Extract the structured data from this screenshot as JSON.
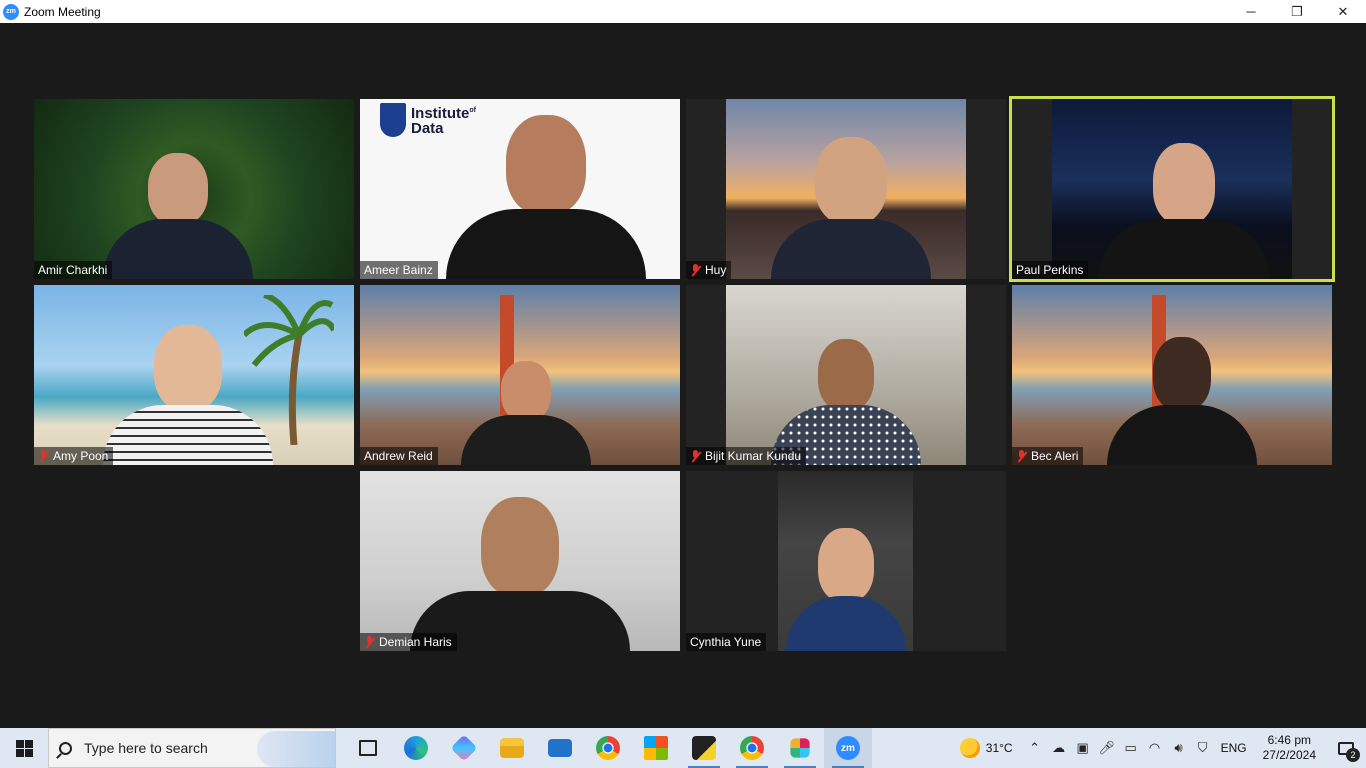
{
  "window": {
    "app_icon": "zm",
    "title": "Zoom Meeting",
    "minimize": "─",
    "restore": "❐",
    "close": "✕"
  },
  "participants": [
    {
      "name": "Amir Charkhi",
      "muted": false,
      "active_speaker": false
    },
    {
      "name": "Ameer Bainz",
      "muted": false,
      "active_speaker": false
    },
    {
      "name": "Huy",
      "muted": true,
      "active_speaker": false
    },
    {
      "name": "Paul Perkins",
      "muted": false,
      "active_speaker": true
    },
    {
      "name": "Amy Poon",
      "muted": true,
      "active_speaker": false
    },
    {
      "name": "Andrew Reid",
      "muted": false,
      "active_speaker": false
    },
    {
      "name": "Bijit Kumar Kundu",
      "muted": true,
      "active_speaker": false
    },
    {
      "name": "Bec Aleri",
      "muted": true,
      "active_speaker": false
    },
    {
      "name": "Demian Haris",
      "muted": true,
      "active_speaker": false
    },
    {
      "name": "Cynthia Yune",
      "muted": false,
      "active_speaker": false
    }
  ],
  "logo": {
    "line1": "Institute",
    "sup": "of",
    "line2": "Data"
  },
  "taskbar": {
    "search_placeholder": "Type here to search",
    "weather_temp": "31°C",
    "language": "ENG",
    "time": "6:46 pm",
    "date": "27/2/2024",
    "notification_count": "2",
    "apps": [
      "task-view",
      "edge",
      "copilot",
      "file-explorer",
      "mail",
      "chrome",
      "store",
      "sticky-notes",
      "chrome-profile",
      "slack",
      "zoom"
    ]
  },
  "colors": {
    "active_speaker_border": "#c9e04a",
    "mute_icon": "#e0312d",
    "zoom_blue": "#2d8cff"
  }
}
